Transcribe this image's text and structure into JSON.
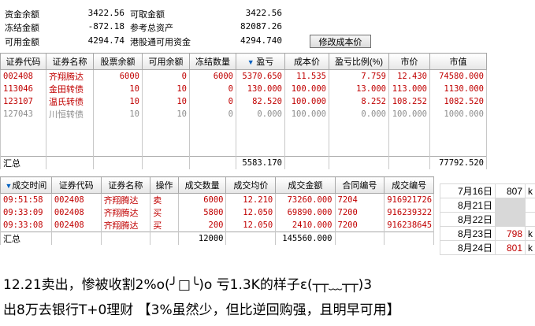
{
  "summary": {
    "fund_balance_label": "资金余额",
    "fund_balance": "3422.56",
    "withdrawable_label": "可取金额",
    "withdrawable": "3422.56",
    "frozen_label": "冻结金额",
    "frozen": "-872.18",
    "ref_assets_label": "参考总资产",
    "ref_assets": "82087.26",
    "available_label": "可用金额",
    "available": "4294.74",
    "hk_connect_label": "港股通可用资金",
    "hk_connect": "4294.740",
    "edit_cost_button": "修改成本价"
  },
  "positions": {
    "headers": [
      "证券代码",
      "证券名称",
      "股票余额",
      "可用余额",
      "冻结数量",
      "盈亏",
      "成本价",
      "盈亏比例(%)",
      "市价",
      "市值"
    ],
    "rows": [
      [
        "002408",
        "齐翔腾达",
        "6000",
        "0",
        "6000",
        "5370.650",
        "11.535",
        "7.759",
        "12.430",
        "74580.000"
      ],
      [
        "113046",
        "金田转债",
        "10",
        "10",
        "0",
        "130.000",
        "100.000",
        "13.000",
        "113.000",
        "1130.000"
      ],
      [
        "123107",
        "温氏转债",
        "10",
        "10",
        "0",
        "82.520",
        "100.000",
        "8.252",
        "108.252",
        "1082.520"
      ],
      [
        "127043",
        "川恒转债",
        "10",
        "10",
        "0",
        "0.000",
        "100.000",
        "0.000",
        "100.000",
        "1000.000"
      ]
    ],
    "total_label": "汇总",
    "total_pnl": "5583.170",
    "total_value": "77792.520"
  },
  "trades": {
    "headers": [
      "成交时间",
      "证券代码",
      "证券名称",
      "操作",
      "成交数量",
      "成交均价",
      "成交金额",
      "合同编号",
      "成交编号"
    ],
    "rows": [
      [
        "09:51:58",
        "002408",
        "齐翔腾达",
        "卖",
        "6000",
        "12.210",
        "73260.000",
        "7204",
        "916921726"
      ],
      [
        "09:33:09",
        "002408",
        "齐翔腾达",
        "买",
        "5800",
        "12.050",
        "69890.000",
        "7200",
        "916239322"
      ],
      [
        "09:33:08",
        "002408",
        "齐翔腾达",
        "买",
        "200",
        "12.050",
        "2410.000",
        "7200",
        "916238645"
      ]
    ],
    "total_label": "汇总",
    "total_qty": "12000",
    "total_amount": "145560.000"
  },
  "side_list": [
    {
      "date": "7月16日",
      "value": "807",
      "unit": "k"
    },
    {
      "date": "8月21日",
      "value": "",
      "unit": ""
    },
    {
      "date": "8月22日",
      "value": "",
      "unit": ""
    },
    {
      "date": "8月23日",
      "value": "798",
      "unit": "k"
    },
    {
      "date": "8月24日",
      "value": "801",
      "unit": "k"
    }
  ],
  "caption": {
    "line1": "12.21卖出，惨被收割2%o(╯□╰)o    亏1.3K的样子ε(┬┬﹏┬┬)3",
    "line2": "出8万去银行T+0理财    【3%虽然少，但比逆回购强，且明早可用】"
  },
  "colors": {
    "loss_red": "#c00000",
    "muted_gray": "#8c8c8c",
    "sort_arrow": "#0060c0"
  }
}
